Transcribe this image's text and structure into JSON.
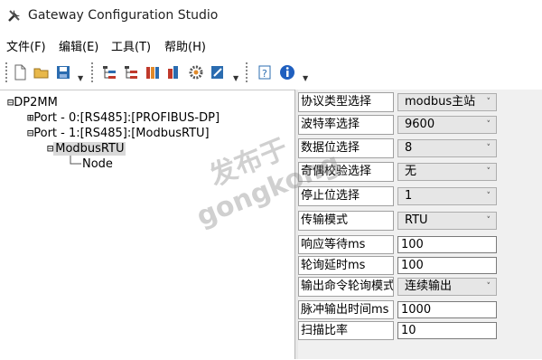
{
  "window": {
    "title": "Gateway Configuration Studio"
  },
  "menu": [
    "文件(F)",
    "编辑(E)",
    "工具(T)",
    "帮助(H)"
  ],
  "toolbar": {
    "icons": [
      "new-file-icon",
      "open-folder-icon",
      "save-icon",
      "add-node-icon",
      "delete-node-icon",
      "import-icon",
      "export-icon",
      "settings-gear-icon",
      "edit-icon",
      "help-about-icon",
      "info-icon"
    ]
  },
  "tree": {
    "root": "DP2MM",
    "port0": "Port - 0:[RS485]:[PROFIBUS-DP]",
    "port1": "Port - 1:[RS485]:[ModbusRTU]",
    "protocol": "ModbusRTU",
    "node": "Node",
    "expand_plus": "⊞",
    "collapse_minus": "⊟"
  },
  "properties": [
    {
      "label": "协议类型选择",
      "value": "modbus主站",
      "kind": "select"
    },
    {
      "label": "波特率选择",
      "value": "9600",
      "kind": "select"
    },
    {
      "label": "数据位选择",
      "value": "8",
      "kind": "select"
    },
    {
      "label": "奇偶校验选择",
      "value": "无",
      "kind": "select"
    },
    {
      "label": "停止位选择",
      "value": "1",
      "kind": "select"
    },
    {
      "label": "传输模式",
      "value": "RTU",
      "kind": "select"
    },
    {
      "label": "响应等待ms",
      "value": "100",
      "kind": "input"
    },
    {
      "label": "轮询延时ms",
      "value": "100",
      "kind": "input"
    },
    {
      "label": "输出命令轮询模式",
      "value": "连续输出",
      "kind": "select"
    },
    {
      "label": "脉冲输出时间ms",
      "value": "1000",
      "kind": "input"
    },
    {
      "label": "扫描比率",
      "value": "10",
      "kind": "input"
    }
  ],
  "watermark": {
    "line1": "发布于",
    "line2": "gongkong"
  },
  "colors": {
    "save_blue": "#2b6cb0",
    "info_blue": "#1f5fbf",
    "selection": "#d9d9d9"
  }
}
